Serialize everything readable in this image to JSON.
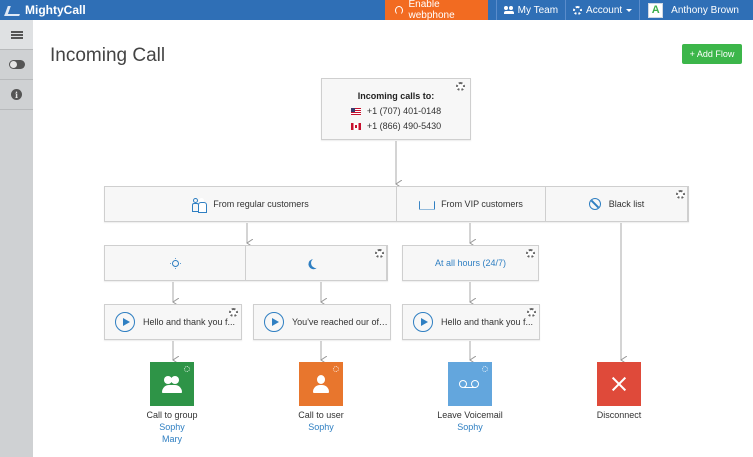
{
  "app": {
    "name": "MightyCall"
  },
  "header": {
    "webphone_label": "Enable webphone",
    "team_label": "My Team",
    "account_label": "Account",
    "user_name": "Anthony Brown",
    "avatar_letter": "A"
  },
  "page": {
    "title": "Incoming Call",
    "add_flow_label": "+ Add Flow"
  },
  "flow": {
    "incoming": {
      "title": "Incoming calls to:",
      "numbers": [
        "+1 (707) 401-0148",
        "+1 (866) 490-5430"
      ]
    },
    "segments": [
      "From regular customers",
      "From VIP customers",
      "Black list"
    ],
    "schedule": {
      "all_hours": "At all hours (24/7)"
    },
    "greetings": [
      "Hello and thank you f...",
      "You've reached our offi...",
      "Hello and thank you f..."
    ],
    "actions": [
      {
        "label": "Call to group",
        "subs": [
          "Sophy",
          "Mary"
        ],
        "icon": "group-icon",
        "color": "#2e9447"
      },
      {
        "label": "Call to user",
        "subs": [
          "Sophy"
        ],
        "icon": "user-icon",
        "color": "#e8762d"
      },
      {
        "label": "Leave Voicemail",
        "subs": [
          "Sophy"
        ],
        "icon": "voicemail-icon",
        "color": "#63a6dd"
      },
      {
        "label": "Disconnect",
        "subs": [],
        "icon": "x-icon",
        "color": "#df4a3a"
      }
    ]
  }
}
